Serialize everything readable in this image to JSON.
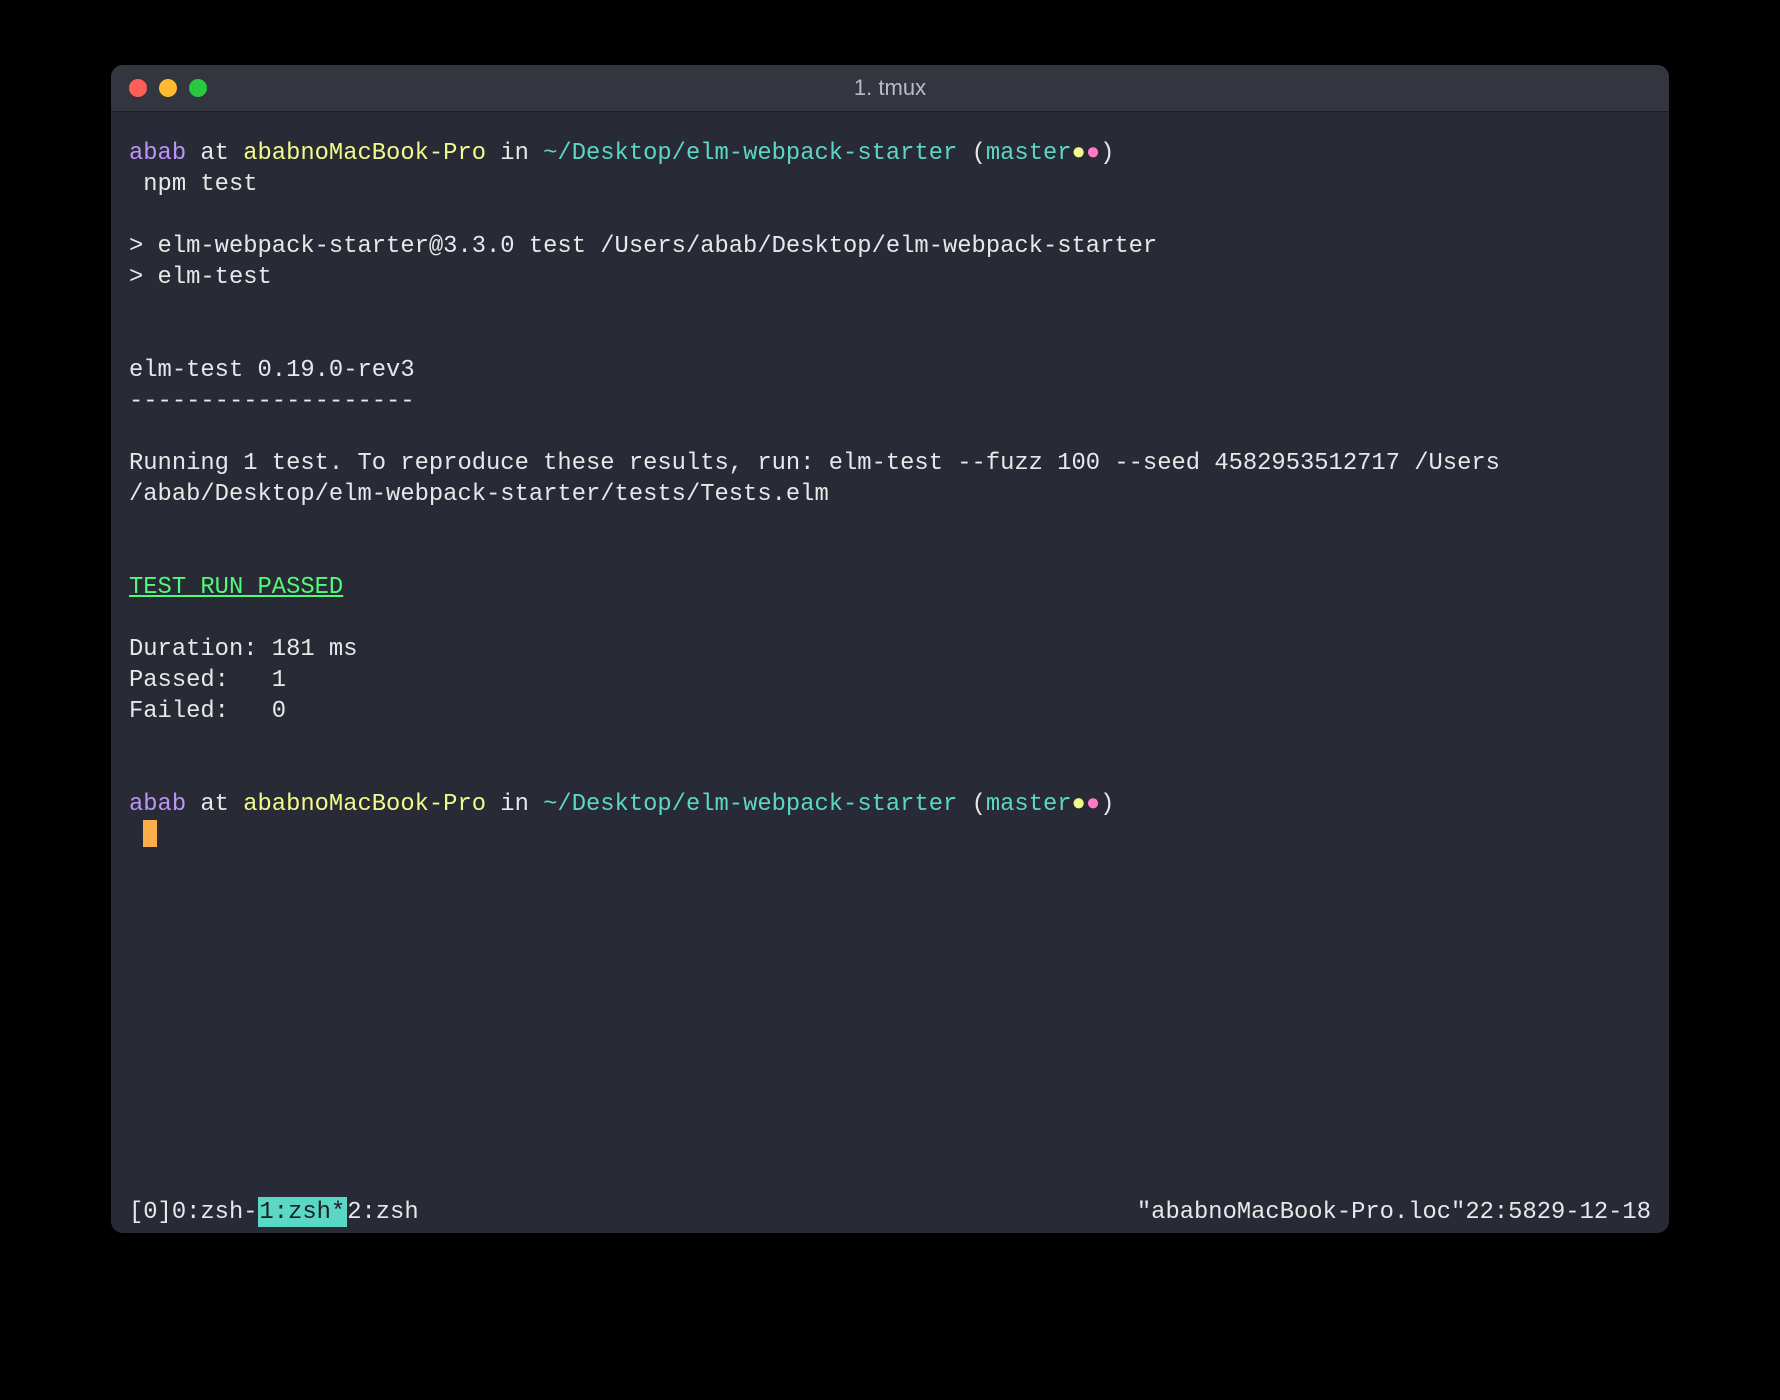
{
  "window": {
    "title": "1. tmux"
  },
  "prompt1": {
    "user": "abab",
    "at": " at ",
    "host": "ababnoMacBook-Pro",
    "in": " in ",
    "path": "~/Desktop/elm-webpack-starter",
    "open": " (",
    "branch": "master",
    "dot1": "●",
    "dot2": "●",
    "close": ")"
  },
  "command": " npm test",
  "npm_out1": "> elm-webpack-starter@3.3.0 test /Users/abab/Desktop/elm-webpack-starter",
  "npm_out2": "> elm-test",
  "test_version": "elm-test 0.19.0-rev3",
  "divider": "--------------------",
  "running_line": "Running 1 test. To reproduce these results, run: elm-test --fuzz 100 --seed 4582953512717 /Users/abab/Desktop/elm-webpack-starter/tests/Tests.elm",
  "result_heading": "TEST RUN PASSED",
  "stats": {
    "duration": "Duration: 181 ms",
    "passed": "Passed:   1",
    "failed": "Failed:   0"
  },
  "prompt2": {
    "user": "abab",
    "at": " at ",
    "host": "ababnoMacBook-Pro",
    "in": " in ",
    "path": "~/Desktop/elm-webpack-starter",
    "open": " (",
    "branch": "master",
    "dot1": "●",
    "dot2": "●",
    "close": ")"
  },
  "cursor_prefix": " ",
  "statusbar": {
    "session": "[0] ",
    "win0": "0:zsh- ",
    "win1": "1:zsh*",
    "win2": " 2:zsh",
    "hostname": "\"ababnoMacBook-Pro.loc\"",
    "time": " 22:58 ",
    "date": "29-12-18"
  }
}
